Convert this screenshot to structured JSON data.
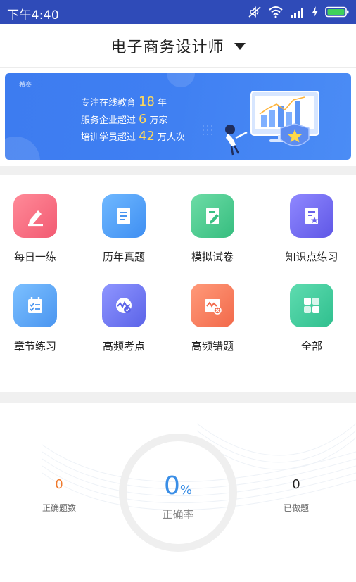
{
  "status_bar": {
    "time": "下午4:40",
    "icons": [
      "mute-icon",
      "wifi-icon",
      "signal-icon",
      "charging-icon",
      "battery-icon"
    ],
    "battery_color": "#3fd15b"
  },
  "header": {
    "title": "电子商务设计师",
    "dropdown_icon": "caret-down-icon"
  },
  "banner": {
    "brand": "希赛",
    "line1": {
      "prefix": "专注在线教育",
      "number": "18",
      "suffix": "年"
    },
    "line2": {
      "prefix": "服务企业超过",
      "number": "6",
      "suffix": "万家"
    },
    "line3": {
      "prefix": "培训学员超过",
      "number": "42",
      "suffix": "万人次"
    }
  },
  "menu": {
    "items": [
      {
        "label": "每日一练",
        "icon": "pencil-icon",
        "color_from": "#ff8a98",
        "color_to": "#f25a72"
      },
      {
        "label": "历年真题",
        "icon": "document-icon",
        "color_from": "#6fb8ff",
        "color_to": "#3f8ff2"
      },
      {
        "label": "模拟试卷",
        "icon": "edit-paper-icon",
        "color_from": "#6ddca6",
        "color_to": "#36bd7f"
      },
      {
        "label": "知识点练习",
        "icon": "star-note-icon",
        "color_from": "#8f88ff",
        "color_to": "#5f57e6"
      },
      {
        "label": "章节练习",
        "icon": "checklist-icon",
        "color_from": "#7cc0ff",
        "color_to": "#4a95f0"
      },
      {
        "label": "高频考点",
        "icon": "wave-check-icon",
        "color_from": "#8f96ff",
        "color_to": "#5b63e8"
      },
      {
        "label": "高频错题",
        "icon": "wave-error-icon",
        "color_from": "#ff9a7a",
        "color_to": "#f2694a"
      },
      {
        "label": "全部",
        "icon": "grid-icon",
        "color_from": "#5fdcb0",
        "color_to": "#2fbf8e"
      }
    ]
  },
  "stats": {
    "correct_count": "0",
    "correct_count_label": "正确题数",
    "rate_value": "0",
    "rate_unit": "%",
    "rate_label": "正确率",
    "done_count": "0",
    "done_count_label": "已做题",
    "correct_color": "#f07a2c",
    "rate_color": "#3a8ee6"
  }
}
